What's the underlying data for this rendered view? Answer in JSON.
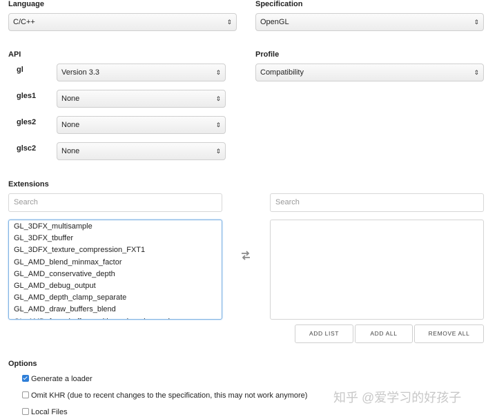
{
  "language": {
    "label": "Language",
    "value": "C/C++"
  },
  "specification": {
    "label": "Specification",
    "value": "OpenGL"
  },
  "api": {
    "label": "API",
    "rows": [
      {
        "name": "gl",
        "value": "Version 3.3"
      },
      {
        "name": "gles1",
        "value": "None"
      },
      {
        "name": "gles2",
        "value": "None"
      },
      {
        "name": "glsc2",
        "value": "None"
      }
    ]
  },
  "profile": {
    "label": "Profile",
    "value": "Compatibility"
  },
  "extensions": {
    "label": "Extensions",
    "left_search_placeholder": "Search",
    "right_search_placeholder": "Search",
    "available": [
      "GL_3DFX_multisample",
      "GL_3DFX_tbuffer",
      "GL_3DFX_texture_compression_FXT1",
      "GL_AMD_blend_minmax_factor",
      "GL_AMD_conservative_depth",
      "GL_AMD_debug_output",
      "GL_AMD_depth_clamp_separate",
      "GL_AMD_draw_buffers_blend",
      "GL_AMD_framebuffer_multisample_advanced"
    ],
    "selected": [],
    "add_list_label": "ADD LIST",
    "add_all_label": "ADD ALL",
    "remove_all_label": "REMOVE ALL"
  },
  "options": {
    "label": "Options",
    "items": [
      {
        "label": "Generate a loader",
        "checked": true
      },
      {
        "label": "Omit KHR (due to recent changes to the specification, this may not work anymore)",
        "checked": false
      },
      {
        "label": "Local Files",
        "checked": false
      }
    ]
  },
  "watermark": "知乎 @爱学习的好孩子",
  "icons": {
    "select_arrows": "updown-arrows-icon",
    "swap": "swap-arrows-icon"
  }
}
